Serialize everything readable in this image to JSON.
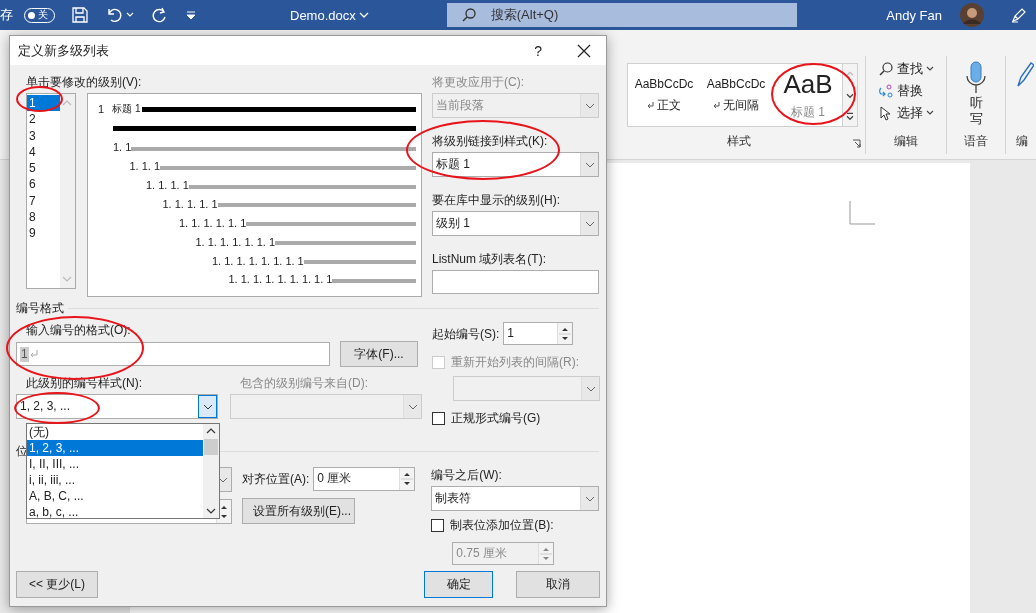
{
  "title_bar": {
    "autosave_label": "存",
    "autosave_toggle": {
      "label": "关",
      "on": false
    },
    "document": "Demo.docx",
    "search_placeholder": "搜索(Alt+Q)",
    "user": "Andy Fan"
  },
  "ribbon": {
    "styles": {
      "label": "样式",
      "items": [
        {
          "preview": "AaBbCcDc",
          "name": "正文",
          "kind": "normal"
        },
        {
          "preview": "AaBbCcDc",
          "name": "无间隔",
          "kind": "normal"
        },
        {
          "preview": "AaB",
          "name": "标题 1",
          "kind": "heading"
        }
      ]
    },
    "editing": {
      "label": "编辑",
      "items": [
        {
          "label": "查找",
          "kind": "find",
          "dropdown": true
        },
        {
          "label": "替换",
          "kind": "replace",
          "dropdown": false
        },
        {
          "label": "选择",
          "kind": "select",
          "dropdown": true
        }
      ]
    },
    "voice": {
      "label": "语音",
      "button": "听写"
    },
    "editor": {
      "label": "编"
    }
  },
  "dialog": {
    "title": "定义新多级列表",
    "help": "?",
    "levels": {
      "label": "单击要修改的级别(V):",
      "items": [
        {
          "label": "1",
          "selected": true
        },
        {
          "label": "2",
          "selected": false
        },
        {
          "label": "3",
          "selected": false
        },
        {
          "label": "4",
          "selected": false
        },
        {
          "label": "5",
          "selected": false
        },
        {
          "label": "6",
          "selected": false
        },
        {
          "label": "7",
          "selected": false
        },
        {
          "label": "8",
          "selected": false
        },
        {
          "label": "9",
          "selected": false
        }
      ]
    },
    "preview": {
      "rows": [
        {
          "kind": "heading",
          "number": "1",
          "caption": "标题 1"
        },
        {
          "kind": "continuation"
        },
        {
          "kind": "sub",
          "number": "1. 1"
        },
        {
          "kind": "sub",
          "number": "1. 1. 1"
        },
        {
          "kind": "sub",
          "number": "1. 1. 1. 1"
        },
        {
          "kind": "sub",
          "number": "1. 1. 1. 1. 1"
        },
        {
          "kind": "sub",
          "number": "1. 1. 1. 1. 1. 1"
        },
        {
          "kind": "sub",
          "number": "1. 1. 1. 1. 1. 1. 1"
        },
        {
          "kind": "sub",
          "number": "1. 1. 1. 1. 1. 1. 1. 1"
        },
        {
          "kind": "sub",
          "number": "1. 1. 1. 1. 1. 1. 1. 1. 1"
        }
      ]
    },
    "apply_to": {
      "label": "将更改应用于(C):",
      "value": "当前段落",
      "disabled": true
    },
    "link_style": {
      "label": "将级别链接到样式(K):",
      "value": "标题 1"
    },
    "gallery_level": {
      "label": "要在库中显示的级别(H):",
      "value": "级别 1"
    },
    "listnum": {
      "label": "ListNum 域列表名(T):"
    },
    "number_format": {
      "section": "编号格式",
      "format_label": "输入编号的格式(O):",
      "format_value": "1",
      "font_button": "字体(F)...",
      "style_label": "此级别的编号样式(N):",
      "style_value": "1, 2, 3, ...",
      "include_label": "包含的级别编号来自(D):",
      "include_disabled": true,
      "start_label": "起始编号(S):",
      "start_value": "1",
      "restart": {
        "label": "重新开始列表的间隔(R):",
        "checked": false,
        "disabled": true
      },
      "legal": {
        "label": "正规形式编号(G)",
        "checked": false
      }
    },
    "style_options": [
      {
        "label": "(无)",
        "selected": false
      },
      {
        "label": "1, 2, 3, ...",
        "selected": true
      },
      {
        "label": "I, II, III, ...",
        "selected": false
      },
      {
        "label": "i, ii, iii, ...",
        "selected": false
      },
      {
        "label": "A, B, C, ...",
        "selected": false
      },
      {
        "label": "a, b, c, ...",
        "selected": false
      }
    ],
    "position": {
      "section": "位",
      "aligned_label": "对齐位置(A):",
      "aligned_value": "0 厘米",
      "set_all_button": "设置所有级别(E)...",
      "follow_label": "编号之后(W):",
      "follow_value": "制表符",
      "tab_stop": {
        "label": "制表位添加位置(B):",
        "checked": false
      },
      "tab_value": "0.75 厘米",
      "tab_disabled": true
    },
    "buttons": [
      {
        "label": "<< 更少(L)",
        "kind": "less"
      },
      {
        "label": "确定",
        "kind": "ok"
      },
      {
        "label": "取消",
        "kind": "cancel"
      }
    ]
  }
}
